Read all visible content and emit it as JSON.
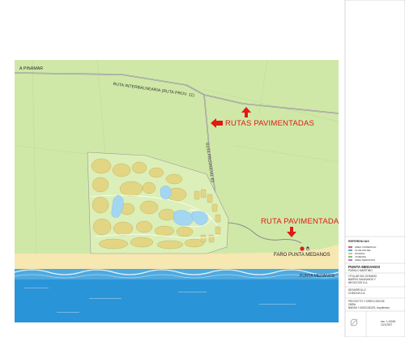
{
  "map": {
    "labels": {
      "a_pinamar": "A PINAMAR",
      "ruta_interbalnearia": "RUTA INTERBALNEARIA (RUTA PROV. 11)",
      "ruta_provincial": "RUTA PROVINCIAL 63",
      "rutas_pavimentadas": "RUTAS PAVIMENTADAS",
      "ruta_pavimentada": "RUTA PAVIMENTADA",
      "faro": "FARO PUNTA MEDANOS",
      "punta_medanos": "PUNTA MEDANOS"
    },
    "colors": {
      "land": "#cfe8a8",
      "beach": "#f7e9b0",
      "sea": "#1e8fd6",
      "lot": "#e3d585",
      "lake": "#9fd3ee",
      "road": "#8c8c8c",
      "arrow": "#e01a14"
    }
  },
  "titleblock": {
    "references_title": "REFERENCIAS",
    "legend": [
      {
        "label": "AREA COMERCIAL",
        "color": "#e06060"
      },
      {
        "label": "CLUB HOUSE",
        "color": "#60a0e0"
      },
      {
        "label": "POSADA",
        "color": "#e0c060"
      },
      {
        "label": "VIVIENDA",
        "color": "#80c080"
      },
      {
        "label": "AREA SERVICIOS",
        "color": "#b080c0"
      }
    ],
    "project_name": "PUNTA MEDANOS",
    "project_sub": "PUEBLO MARITIMO",
    "owner_lines": [
      "TITULAR DEL DOMINIO",
      "BARRIO SANDANOS Y",
      "NEGOCIOS S.A."
    ],
    "developer_lines": [
      "DESARROLLO",
      "CHINCHA S.A."
    ],
    "design_lines": [
      "PROYECTO Y DIRECCION DE",
      "OBRA",
      "BAEAN Y ASOCIADOS, Arquitectos"
    ],
    "sheet_code": "esc. 1:10000",
    "sheet_num": "12/1/2007"
  }
}
